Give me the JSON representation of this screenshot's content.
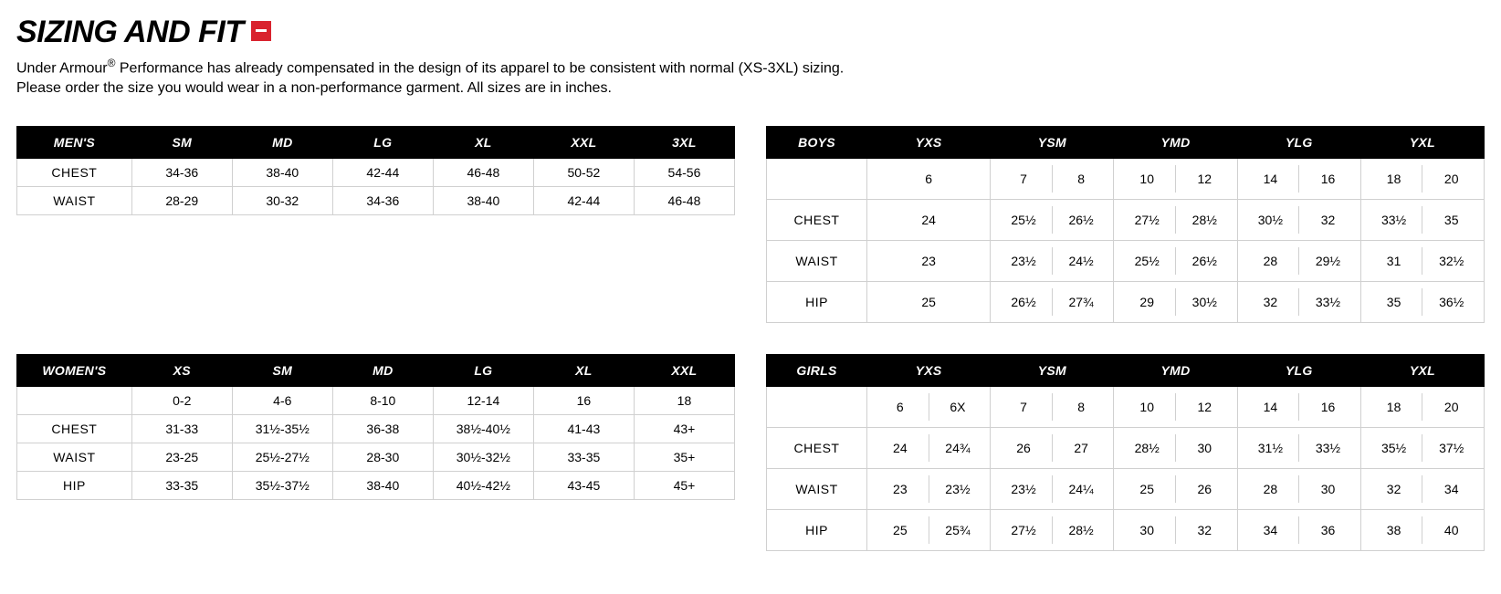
{
  "header": {
    "title": "SIZING AND FIT",
    "collapse_icon": "minus-icon",
    "intro_html": "Under Armour<sup>®</sup> Performance has already compensated in the design of its apparel to be consistent with normal (XS-3XL) sizing.<br>Please order the size you would wear in a non-performance garment. All sizes are in inches."
  },
  "charts": {
    "mens": {
      "title": "MEN'S",
      "sizes": [
        "SM",
        "MD",
        "LG",
        "XL",
        "XXL",
        "3XL"
      ],
      "rows": [
        {
          "label": "CHEST",
          "values": [
            "34-36",
            "38-40",
            "42-44",
            "46-48",
            "50-52",
            "54-56"
          ]
        },
        {
          "label": "WAIST",
          "values": [
            "28-29",
            "30-32",
            "34-36",
            "38-40",
            "42-44",
            "46-48"
          ]
        }
      ]
    },
    "womens": {
      "title": "WOMEN'S",
      "sizes": [
        "XS",
        "SM",
        "MD",
        "LG",
        "XL",
        "XXL"
      ],
      "rows": [
        {
          "label": "",
          "values": [
            "0-2",
            "4-6",
            "8-10",
            "12-14",
            "16",
            "18"
          ]
        },
        {
          "label": "CHEST",
          "values": [
            "31-33",
            "31½-35½",
            "36-38",
            "38½-40½",
            "41-43",
            "43+"
          ]
        },
        {
          "label": "WAIST",
          "values": [
            "23-25",
            "25½-27½",
            "28-30",
            "30½-32½",
            "33-35",
            "35+"
          ]
        },
        {
          "label": "HIP",
          "values": [
            "33-35",
            "35½-37½",
            "38-40",
            "40½-42½",
            "43-45",
            "45+"
          ]
        }
      ]
    },
    "boys": {
      "title": "BOYS",
      "sizes": [
        "YXS",
        "YSM",
        "YMD",
        "YLG",
        "YXL"
      ],
      "rows": [
        {
          "label": "",
          "values": [
            [
              "6",
              ""
            ],
            [
              "7",
              "8"
            ],
            [
              "10",
              "12"
            ],
            [
              "14",
              "16"
            ],
            [
              "18",
              "20"
            ]
          ]
        },
        {
          "label": "CHEST",
          "values": [
            [
              "24",
              ""
            ],
            [
              "25½",
              "26½"
            ],
            [
              "27½",
              "28½"
            ],
            [
              "30½",
              "32"
            ],
            [
              "33½",
              "35"
            ]
          ]
        },
        {
          "label": "WAIST",
          "values": [
            [
              "23",
              ""
            ],
            [
              "23½",
              "24½"
            ],
            [
              "25½",
              "26½"
            ],
            [
              "28",
              "29½"
            ],
            [
              "31",
              "32½"
            ]
          ]
        },
        {
          "label": "HIP",
          "values": [
            [
              "25",
              ""
            ],
            [
              "26½",
              "27¾"
            ],
            [
              "29",
              "30½"
            ],
            [
              "32",
              "33½"
            ],
            [
              "35",
              "36½"
            ]
          ]
        }
      ]
    },
    "girls": {
      "title": "GIRLS",
      "sizes": [
        "YXS",
        "YSM",
        "YMD",
        "YLG",
        "YXL"
      ],
      "rows": [
        {
          "label": "",
          "values": [
            [
              "6",
              "6X"
            ],
            [
              "7",
              "8"
            ],
            [
              "10",
              "12"
            ],
            [
              "14",
              "16"
            ],
            [
              "18",
              "20"
            ]
          ]
        },
        {
          "label": "CHEST",
          "values": [
            [
              "24",
              "24¾"
            ],
            [
              "26",
              "27"
            ],
            [
              "28½",
              "30"
            ],
            [
              "31½",
              "33½"
            ],
            [
              "35½",
              "37½"
            ]
          ]
        },
        {
          "label": "WAIST",
          "values": [
            [
              "23",
              "23½"
            ],
            [
              "23½",
              "24¼"
            ],
            [
              "25",
              "26"
            ],
            [
              "28",
              "30"
            ],
            [
              "32",
              "34"
            ]
          ]
        },
        {
          "label": "HIP",
          "values": [
            [
              "25",
              "25¾"
            ],
            [
              "27½",
              "28½"
            ],
            [
              "30",
              "32"
            ],
            [
              "34",
              "36"
            ],
            [
              "38",
              "40"
            ]
          ]
        }
      ]
    }
  }
}
